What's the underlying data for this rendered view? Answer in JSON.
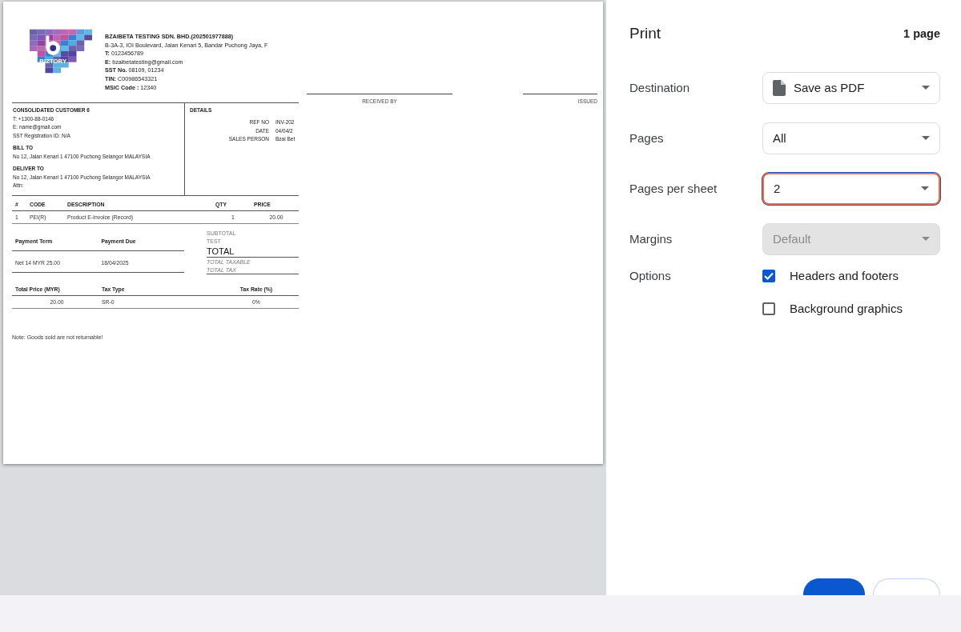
{
  "preview": {
    "logo_text": "BIZTORY",
    "company": {
      "name": "BZAIBETA TESTING SDN. BHD.(202501977888)",
      "address": "B-3A-3, IOI Boulevard, Jalan Kenari 5, Bandar Puchong Jaya, F",
      "lines": [
        {
          "label": "T:",
          "value": "0123456789"
        },
        {
          "label": "E:",
          "value": "bzaibetatesting@gmail.com"
        },
        {
          "label": "SST No.",
          "value": "08109, 01234"
        },
        {
          "label": "TIN:",
          "value": "C00986543321"
        },
        {
          "label": "MSIC Code :",
          "value": "12340"
        }
      ]
    },
    "signatures": [
      "RECEIVED BY",
      "ISSUED"
    ],
    "customer": {
      "name": "CONSOLIDATED CUSTOMER 6",
      "lines": [
        "T: +1300-88-0146",
        "E: name@gmail.com",
        "SST Registration ID: N/A"
      ]
    },
    "bill_to": {
      "heading": "BILL TO",
      "lines": [
        "No 12, Jalan Kenari 1 47100 Puchong Selangor MALAYSIA"
      ]
    },
    "deliver_to": {
      "heading": "DELIVER TO",
      "lines": [
        "No 12, Jalan Kenari 1 47100 Puchong Selangor MALAYSIA",
        "Attn:"
      ]
    },
    "details": {
      "heading": "DETAILS",
      "rows": [
        {
          "label": "REF NO",
          "value": "INV-202"
        },
        {
          "label": "DATE",
          "value": "04/04/2"
        },
        {
          "label": "SALES PERSON",
          "value": "Bzai Bet"
        }
      ]
    },
    "items": {
      "columns": [
        "#",
        "CODE",
        "DESCRIPTION",
        "QTY",
        "PRICE"
      ],
      "rows": [
        [
          "1",
          "PEI(R)",
          "Product E-Invoice (Record)",
          "1",
          "20.00"
        ]
      ]
    },
    "payment": {
      "columns": [
        "Payment Term",
        "Payment Due"
      ],
      "rows": [
        [
          "Net 14 MYR 25.00",
          "18/04/2025"
        ]
      ]
    },
    "totals": [
      {
        "kind": "label",
        "text": "SUBTOTAL"
      },
      {
        "kind": "label",
        "text": "TEST"
      },
      {
        "kind": "total",
        "text": "TOTAL"
      },
      {
        "kind": "italic",
        "text": "TOTAL TAXABLE"
      },
      {
        "kind": "italic",
        "text": "TOTAL TAX"
      }
    ],
    "tax": {
      "columns": [
        "Total Price (MYR)",
        "Tax Type",
        "Tax Rate (%)"
      ],
      "rows": [
        [
          "20.00",
          "SR-0",
          "0%"
        ]
      ]
    },
    "note": "Note: Goods sold are not returnable!"
  },
  "settings": {
    "title": "Print",
    "page_count": "1 page",
    "fields": [
      {
        "label": "Destination",
        "value": "Save as PDF",
        "kind": "select",
        "focused": false,
        "disabled": false
      },
      {
        "label": "Pages",
        "value": "All",
        "kind": "select",
        "focused": false,
        "disabled": false
      },
      {
        "label": "Pages per sheet",
        "value": "2",
        "kind": "select",
        "focused": true,
        "disabled": false
      },
      {
        "label": "Margins",
        "value": "Default",
        "kind": "select",
        "focused": false,
        "disabled": true
      }
    ],
    "options": {
      "label": "Options",
      "checkboxes": [
        {
          "label": "Headers and footers",
          "checked": true
        },
        {
          "label": "Background graphics",
          "checked": false
        }
      ]
    }
  }
}
